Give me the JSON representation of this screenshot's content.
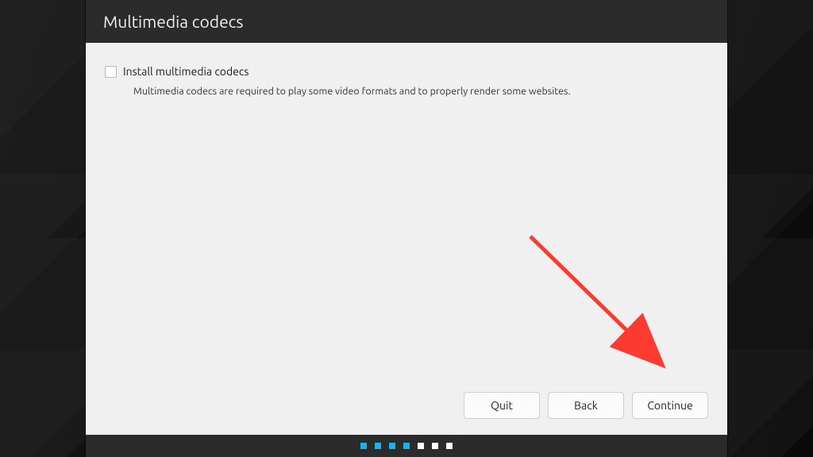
{
  "window": {
    "title": "Multimedia codecs"
  },
  "option": {
    "checkbox_checked": false,
    "label": "Install multimedia codecs",
    "description": "Multimedia codecs are required to play some video formats and to properly render some websites."
  },
  "buttons": {
    "quit": "Quit",
    "back": "Back",
    "continue": "Continue"
  },
  "progress": {
    "total": 7,
    "current": 4
  },
  "colors": {
    "accent": "#19b3e6",
    "panel_bg": "#f0f0f0",
    "chrome_bg": "#2b2b2b",
    "annotation": "#fb3b2f"
  }
}
